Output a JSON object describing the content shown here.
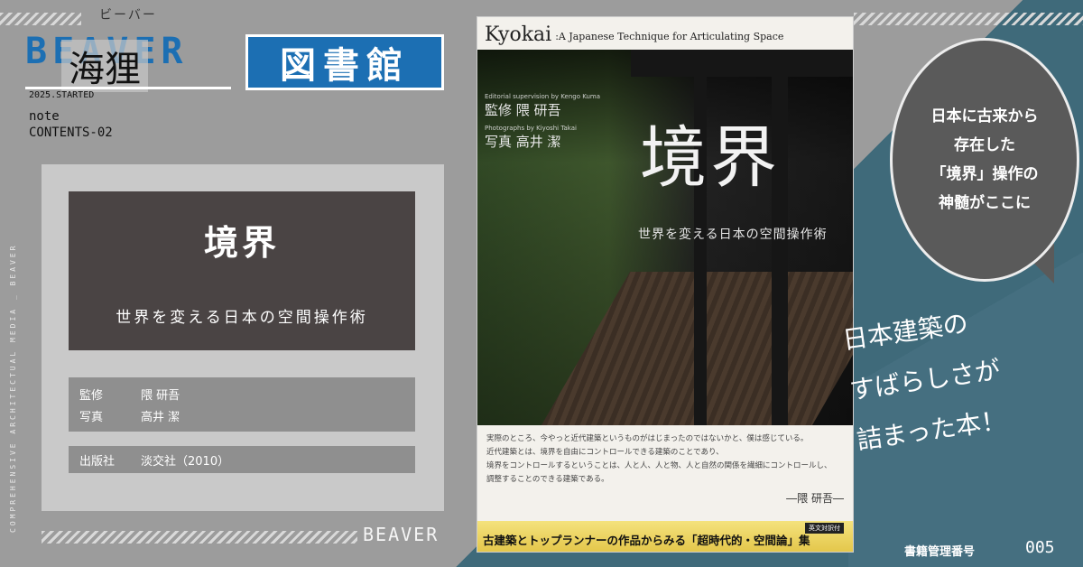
{
  "brand": {
    "logo_latin": "BEAVER",
    "logo_kana": "ビーバー",
    "logo_kanji": "海狸",
    "library_label": "図書館",
    "started": "2025.STARTED",
    "note": "note",
    "contents": "CONTENTS-02",
    "vertical_caption": "COMPREHENSIVE ARCHITECTUAL MEDIA _ BEAVER",
    "footer_brand": "BEAVER"
  },
  "book_info": {
    "title": "境界",
    "subtitle": "世界を変える日本の空間操作術",
    "rows": [
      {
        "label": "監修",
        "value": "隈 研吾"
      },
      {
        "label": "写真",
        "value": "高井 潔"
      }
    ],
    "publisher_label": "出版社",
    "publisher_value": "淡交社（2010）"
  },
  "cover": {
    "head_main": "Kyokai",
    "head_sub": ":A Japanese Technique for Articulating Space",
    "supervision_en": "Editorial supervision by Kengo Kuma",
    "supervision_jp": "監修 隈 研吾",
    "photos_en": "Photographs by Kiyoshi Takai",
    "photos_jp": "写真 高井 潔",
    "big_title": "境界",
    "big_subtitle": "世界を変える日本の空間操作術",
    "quote_lines": [
      "実際のところ、今やっと近代建築というものがはじまったのではないかと、僕は感じている。",
      "近代建築とは、境界を自由にコントロールできる建築のことであり、",
      "境界をコントロールするということは、人と人、人と物、人と自然の関係を繊細にコントロールし、",
      "調整することのできる建築である。"
    ],
    "signature": "―隈 研吾―",
    "band_tag": "英文対訳付",
    "band_text": "古建築とトップランナーの作品からみる「超時代的・空間論」集"
  },
  "bubble": {
    "lines": [
      "日本に古来から",
      "存在した",
      "「境界」操作の",
      "神髄がここに"
    ]
  },
  "handwritten": {
    "lines": [
      "日本建築の",
      "すばらしさが",
      "詰まった本！"
    ]
  },
  "footer": {
    "management_label": "書籍管理番号",
    "management_number": "005"
  },
  "colors": {
    "background": "#9c9c9c",
    "brand_blue": "#1c6fb3",
    "panel_dark": "#4a4444",
    "teal": "#3f6a7a",
    "band_yellow": "#e4c74b"
  }
}
